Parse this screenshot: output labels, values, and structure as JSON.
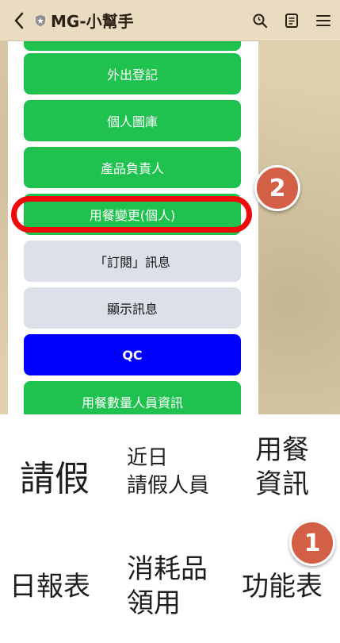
{
  "header": {
    "title": "MG-小幫手",
    "icons": [
      "back-chevron",
      "shield",
      "search",
      "notes",
      "menu"
    ]
  },
  "menu": {
    "items": [
      {
        "label": "外出登記",
        "color": "#1fc24e"
      },
      {
        "label": "個人圖庫",
        "color": "#1fc24e"
      },
      {
        "label": "產品負責人",
        "color": "#1fc24e"
      },
      {
        "label": "用餐變更(個人)",
        "color": "#1fc24e"
      },
      {
        "label": "「訂閱」訊息",
        "color": "#dde0e8"
      },
      {
        "label": "顯示訊息",
        "color": "#dde0e8"
      },
      {
        "label": "QC",
        "color": "#0000ff"
      },
      {
        "label": "用餐數量人員資訊",
        "color": "#1fc24e"
      }
    ]
  },
  "badges": {
    "step1": "1",
    "step2": "2"
  },
  "richmenu": {
    "leave": "請假",
    "recent_leave_1": "近日",
    "recent_leave_2": "請假人員",
    "meal_1": "用餐",
    "meal_2": "資訊",
    "daily_report": "日報表",
    "consumables_1": "消耗品",
    "consumables_2": "領用",
    "function_table": "功能表"
  },
  "colors": {
    "highlight": "#ef0b0b",
    "badge": "#d35f47",
    "header_bg": "#eadcc0"
  }
}
